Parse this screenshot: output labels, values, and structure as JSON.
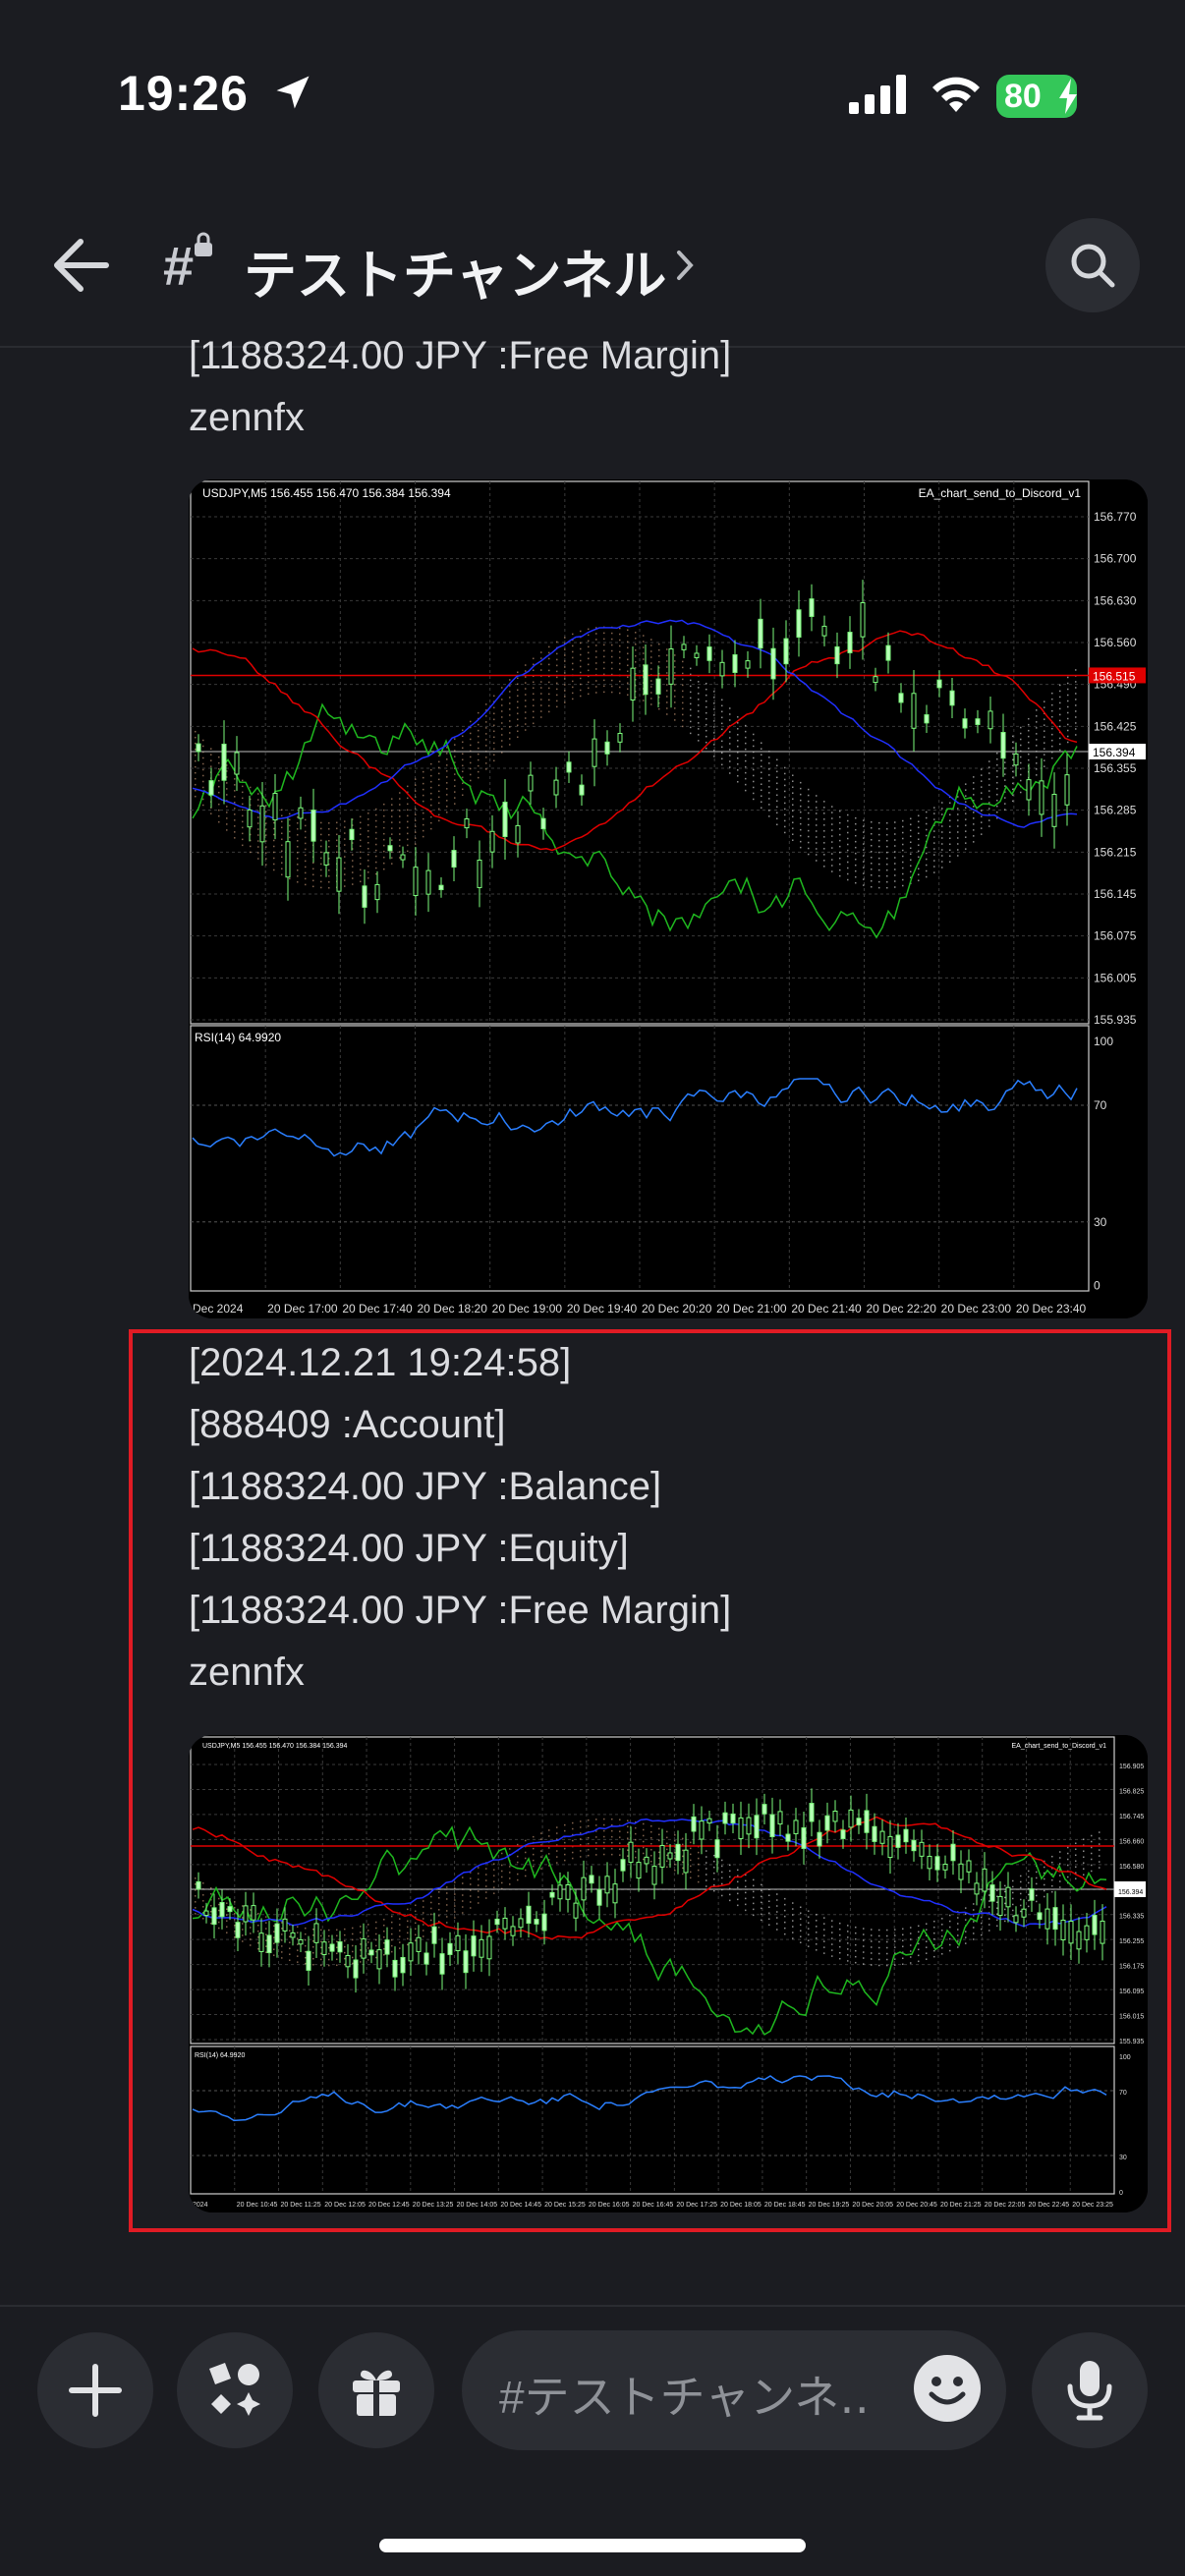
{
  "status_bar": {
    "time": "19:26",
    "battery": "80"
  },
  "header": {
    "channel_name": "テストチャンネル",
    "channel_hash": "#"
  },
  "message_1_tail": {
    "free_margin": "[1188324.00 JPY :Free Margin]",
    "author": "zennfx"
  },
  "message_2": {
    "lines": [
      "[2024.12.21 19:24:58]",
      "[888409 :Account]",
      "[1188324.00 JPY :Balance]",
      "[1188324.00 JPY :Equity]",
      "[1188324.00 JPY :Free Margin]",
      "zennfx"
    ]
  },
  "chart_1": {
    "symbol_label": "USDJPY,M5  156.455 156.470 156.384 156.394",
    "ea_label": "EA_chart_send_to_Discord_v1",
    "price_ticks": [
      "156.770",
      "156.700",
      "156.630",
      "156.560",
      "156.490",
      "156.425",
      "156.355",
      "156.285",
      "156.215",
      "156.145",
      "156.075",
      "156.005",
      "155.935"
    ],
    "bid_tag": "156.394",
    "red_tag": "156.515",
    "rsi_label": "RSI(14) 64.9920",
    "rsi_ticks": [
      "100",
      "70",
      "30",
      "0"
    ],
    "time_ticks": [
      "Dec 2024",
      "20 Dec 17:00",
      "20 Dec 17:40",
      "20 Dec 18:20",
      "20 Dec 19:00",
      "20 Dec 19:40",
      "20 Dec 20:20",
      "20 Dec 21:00",
      "20 Dec 21:40",
      "20 Dec 22:20",
      "20 Dec 23:00",
      "20 Dec 23:40"
    ]
  },
  "chart_2": {
    "symbol_label": "USDJPY,M5  156.455 156.470 156.384 156.394",
    "ea_label": "EA_chart_send_to_Discord_v1",
    "price_ticks": [
      "156.905",
      "156.825",
      "156.745",
      "156.660",
      "156.580",
      "156.415",
      "156.335",
      "156.255",
      "156.175",
      "156.095",
      "156.015",
      "155.935"
    ],
    "bid_tag": "156.394",
    "rsi_label": "RSI(14) 64.9920",
    "rsi_ticks": [
      "100",
      "70",
      "30",
      "0"
    ],
    "time_ticks": [
      "2024",
      "20 Dec 10:45",
      "20 Dec 11:25",
      "20 Dec 12:05",
      "20 Dec 12:45",
      "20 Dec 13:25",
      "20 Dec 14:05",
      "20 Dec 14:45",
      "20 Dec 15:25",
      "20 Dec 16:05",
      "20 Dec 16:45",
      "20 Dec 17:25",
      "20 Dec 18:05",
      "20 Dec 18:45",
      "20 Dec 19:25",
      "20 Dec 20:05",
      "20 Dec 20:45",
      "20 Dec 21:25",
      "20 Dec 22:05",
      "20 Dec 22:45",
      "20 Dec 23:25"
    ]
  },
  "composer": {
    "placeholder": "#テストチャンネ‥"
  },
  "colors": {
    "accent_red": "#e01b24",
    "battery_green": "#34c759",
    "bg": "#1b1c21"
  },
  "icons": [
    "location-arrow-icon",
    "signal-icon",
    "wifi-icon",
    "back-arrow-icon",
    "channel-hash-icon",
    "chevron-right-icon",
    "search-icon",
    "plus-icon",
    "apps-icon",
    "gift-icon",
    "emoji-icon",
    "microphone-icon"
  ]
}
